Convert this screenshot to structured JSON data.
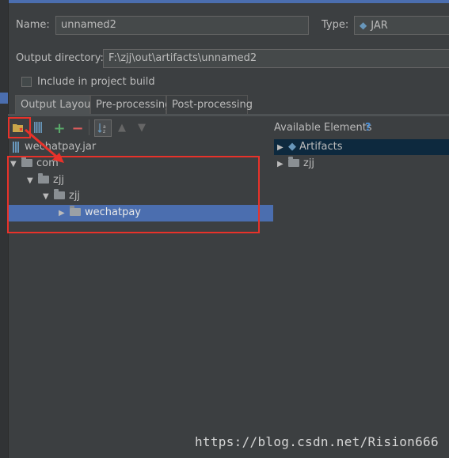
{
  "form": {
    "name_label": "Name:",
    "name_value": "unnamed2",
    "type_label": "Type:",
    "type_value": "JAR",
    "output_dir_label": "Output directory:",
    "output_dir_value": "F:\\zjj\\out\\artifacts\\unnamed2",
    "include_label": "Include in project build",
    "include_checked": false
  },
  "tabs": [
    {
      "label": "Output Layout",
      "active": true
    },
    {
      "label": "Pre-processing",
      "active": false
    },
    {
      "label": "Post-processing",
      "active": false
    }
  ],
  "toolbar": {
    "icons": [
      "new-folder-icon",
      "archive-icon",
      "add-icon",
      "remove-icon",
      "sort-icon",
      "move-up-icon",
      "move-down-icon"
    ]
  },
  "layout_tree": {
    "root_label": "wechatpay.jar",
    "items": [
      {
        "label": "com",
        "expanded": true
      },
      {
        "label": "zjj",
        "expanded": true
      },
      {
        "label": "zjj",
        "expanded": true
      },
      {
        "label": "wechatpay",
        "expanded": false,
        "selected": true
      }
    ]
  },
  "available": {
    "title": "Available Elements",
    "help": "?",
    "items": [
      {
        "label": "Artifacts",
        "selected": true
      },
      {
        "label": "zjj",
        "selected": false
      }
    ]
  },
  "watermark": "https://blog.csdn.net/Rision666",
  "colors": {
    "accent": "#4b6eaf",
    "annotation": "#e8322a",
    "background": "#3c3f41"
  }
}
